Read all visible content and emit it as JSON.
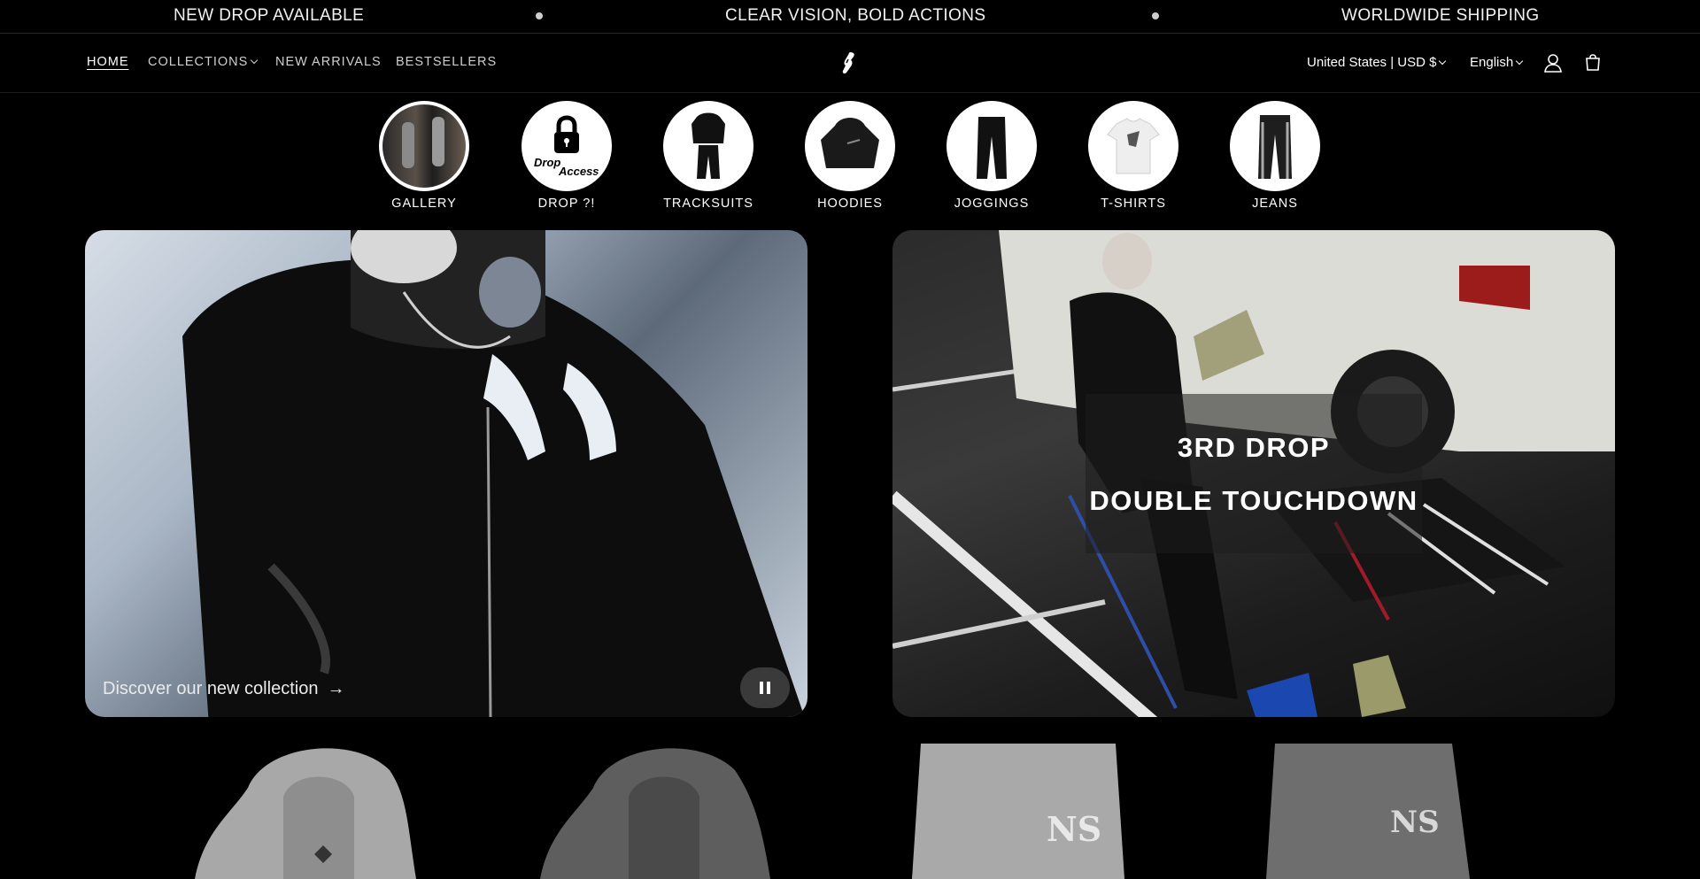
{
  "announcement": {
    "messages": [
      "NEW DROP AVAILABLE",
      "CLEAR VISION, BOLD ACTIONS",
      "WORLDWIDE SHIPPING"
    ]
  },
  "nav": {
    "home": "HOME",
    "collections": "COLLECTIONS",
    "new_arrivals": "NEW ARRIVALS",
    "bestsellers": "BESTSELLERS"
  },
  "header": {
    "currency": "United States | USD $",
    "language": "English"
  },
  "categories": [
    {
      "label": "GALLERY"
    },
    {
      "label": "DROP ?!"
    },
    {
      "label": "TRACKSUITS"
    },
    {
      "label": "HOODIES"
    },
    {
      "label": "JOGGINGS"
    },
    {
      "label": "T-SHIRTS"
    },
    {
      "label": "JEANS"
    }
  ],
  "drop_access_badge": {
    "line1": "Drop",
    "line2": "Access"
  },
  "hero_left": {
    "cta": "Discover our new collection",
    "arrow": "→"
  },
  "hero_right": {
    "line1": "3RD DROP",
    "line2": "DOUBLE TOUCHDOWN"
  },
  "colors": {
    "background": "#000000",
    "text": "#ffffff",
    "muted_nav": "#cfcfcf"
  }
}
